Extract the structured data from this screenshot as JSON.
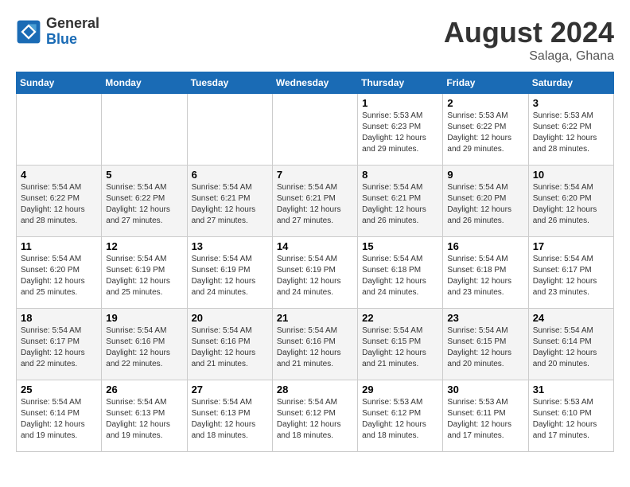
{
  "header": {
    "logo_text_general": "General",
    "logo_text_blue": "Blue",
    "month_title": "August 2024",
    "location": "Salaga, Ghana"
  },
  "days_of_week": [
    "Sunday",
    "Monday",
    "Tuesday",
    "Wednesday",
    "Thursday",
    "Friday",
    "Saturday"
  ],
  "weeks": [
    [
      {
        "day": "",
        "info": ""
      },
      {
        "day": "",
        "info": ""
      },
      {
        "day": "",
        "info": ""
      },
      {
        "day": "",
        "info": ""
      },
      {
        "day": "1",
        "info": "Sunrise: 5:53 AM\nSunset: 6:23 PM\nDaylight: 12 hours\nand 29 minutes."
      },
      {
        "day": "2",
        "info": "Sunrise: 5:53 AM\nSunset: 6:22 PM\nDaylight: 12 hours\nand 29 minutes."
      },
      {
        "day": "3",
        "info": "Sunrise: 5:53 AM\nSunset: 6:22 PM\nDaylight: 12 hours\nand 28 minutes."
      }
    ],
    [
      {
        "day": "4",
        "info": "Sunrise: 5:54 AM\nSunset: 6:22 PM\nDaylight: 12 hours\nand 28 minutes."
      },
      {
        "day": "5",
        "info": "Sunrise: 5:54 AM\nSunset: 6:22 PM\nDaylight: 12 hours\nand 27 minutes."
      },
      {
        "day": "6",
        "info": "Sunrise: 5:54 AM\nSunset: 6:21 PM\nDaylight: 12 hours\nand 27 minutes."
      },
      {
        "day": "7",
        "info": "Sunrise: 5:54 AM\nSunset: 6:21 PM\nDaylight: 12 hours\nand 27 minutes."
      },
      {
        "day": "8",
        "info": "Sunrise: 5:54 AM\nSunset: 6:21 PM\nDaylight: 12 hours\nand 26 minutes."
      },
      {
        "day": "9",
        "info": "Sunrise: 5:54 AM\nSunset: 6:20 PM\nDaylight: 12 hours\nand 26 minutes."
      },
      {
        "day": "10",
        "info": "Sunrise: 5:54 AM\nSunset: 6:20 PM\nDaylight: 12 hours\nand 26 minutes."
      }
    ],
    [
      {
        "day": "11",
        "info": "Sunrise: 5:54 AM\nSunset: 6:20 PM\nDaylight: 12 hours\nand 25 minutes."
      },
      {
        "day": "12",
        "info": "Sunrise: 5:54 AM\nSunset: 6:19 PM\nDaylight: 12 hours\nand 25 minutes."
      },
      {
        "day": "13",
        "info": "Sunrise: 5:54 AM\nSunset: 6:19 PM\nDaylight: 12 hours\nand 24 minutes."
      },
      {
        "day": "14",
        "info": "Sunrise: 5:54 AM\nSunset: 6:19 PM\nDaylight: 12 hours\nand 24 minutes."
      },
      {
        "day": "15",
        "info": "Sunrise: 5:54 AM\nSunset: 6:18 PM\nDaylight: 12 hours\nand 24 minutes."
      },
      {
        "day": "16",
        "info": "Sunrise: 5:54 AM\nSunset: 6:18 PM\nDaylight: 12 hours\nand 23 minutes."
      },
      {
        "day": "17",
        "info": "Sunrise: 5:54 AM\nSunset: 6:17 PM\nDaylight: 12 hours\nand 23 minutes."
      }
    ],
    [
      {
        "day": "18",
        "info": "Sunrise: 5:54 AM\nSunset: 6:17 PM\nDaylight: 12 hours\nand 22 minutes."
      },
      {
        "day": "19",
        "info": "Sunrise: 5:54 AM\nSunset: 6:16 PM\nDaylight: 12 hours\nand 22 minutes."
      },
      {
        "day": "20",
        "info": "Sunrise: 5:54 AM\nSunset: 6:16 PM\nDaylight: 12 hours\nand 21 minutes."
      },
      {
        "day": "21",
        "info": "Sunrise: 5:54 AM\nSunset: 6:16 PM\nDaylight: 12 hours\nand 21 minutes."
      },
      {
        "day": "22",
        "info": "Sunrise: 5:54 AM\nSunset: 6:15 PM\nDaylight: 12 hours\nand 21 minutes."
      },
      {
        "day": "23",
        "info": "Sunrise: 5:54 AM\nSunset: 6:15 PM\nDaylight: 12 hours\nand 20 minutes."
      },
      {
        "day": "24",
        "info": "Sunrise: 5:54 AM\nSunset: 6:14 PM\nDaylight: 12 hours\nand 20 minutes."
      }
    ],
    [
      {
        "day": "25",
        "info": "Sunrise: 5:54 AM\nSunset: 6:14 PM\nDaylight: 12 hours\nand 19 minutes."
      },
      {
        "day": "26",
        "info": "Sunrise: 5:54 AM\nSunset: 6:13 PM\nDaylight: 12 hours\nand 19 minutes."
      },
      {
        "day": "27",
        "info": "Sunrise: 5:54 AM\nSunset: 6:13 PM\nDaylight: 12 hours\nand 18 minutes."
      },
      {
        "day": "28",
        "info": "Sunrise: 5:54 AM\nSunset: 6:12 PM\nDaylight: 12 hours\nand 18 minutes."
      },
      {
        "day": "29",
        "info": "Sunrise: 5:53 AM\nSunset: 6:12 PM\nDaylight: 12 hours\nand 18 minutes."
      },
      {
        "day": "30",
        "info": "Sunrise: 5:53 AM\nSunset: 6:11 PM\nDaylight: 12 hours\nand 17 minutes."
      },
      {
        "day": "31",
        "info": "Sunrise: 5:53 AM\nSunset: 6:10 PM\nDaylight: 12 hours\nand 17 minutes."
      }
    ]
  ]
}
